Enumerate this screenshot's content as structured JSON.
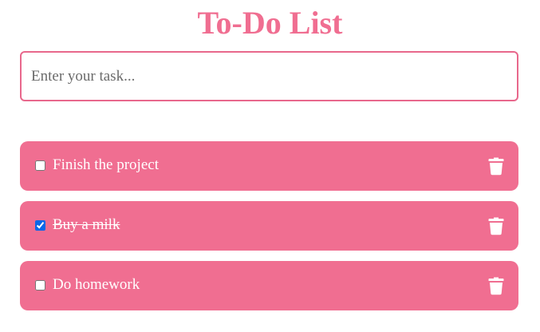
{
  "app": {
    "title": "To-Do List"
  },
  "input": {
    "placeholder": "Enter your task...",
    "value": ""
  },
  "tasks": [
    {
      "text": "Finish the project",
      "completed": false
    },
    {
      "text": "Buy a milk",
      "completed": true
    },
    {
      "text": "Do homework",
      "completed": false
    }
  ],
  "icons": {
    "delete": "trash-icon"
  },
  "colors": {
    "accent": "#f06e91",
    "input_border": "#e8688c",
    "task_text": "#ffffff",
    "checkbox_checked": "#0b67e8"
  }
}
